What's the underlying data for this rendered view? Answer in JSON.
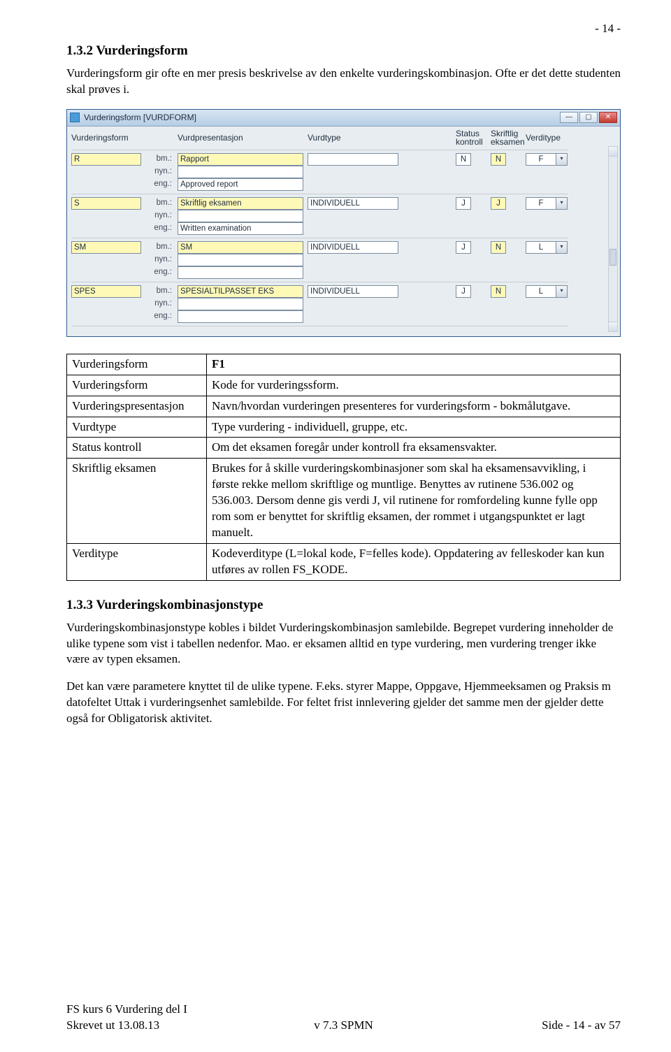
{
  "page_number_top": "- 14 -",
  "section_heading": "1.3.2 Vurderingsform",
  "intro_para": "Vurderingsform gir ofte en mer presis beskrivelse av den enkelte vurderingskombinasjon. Ofte er det dette studenten skal prøves i.",
  "window": {
    "title": "Vurderingsform  [VURDFORM]",
    "columns": {
      "c1": "Vurderingsform",
      "c2": "Vurdpresentasjon",
      "c3": "Vurdtype",
      "c4a": "Status",
      "c4b": "kontroll",
      "c5a": "Skriftlig",
      "c5b": "eksamen",
      "c6": "Verditype"
    },
    "rows": [
      {
        "code": "R",
        "bm": "Rapport",
        "type": "",
        "status": "N",
        "skriftlig": "N",
        "verdi": "F",
        "nyn": "",
        "eng": "Approved report"
      },
      {
        "code": "S",
        "bm": "Skriftlig eksamen",
        "type": "INDIVIDUELL",
        "status": "J",
        "skriftlig": "J",
        "verdi": "F",
        "nyn": "",
        "eng": "Written examination"
      },
      {
        "code": "SM",
        "bm": "SM",
        "type": "INDIVIDUELL",
        "status": "J",
        "skriftlig": "N",
        "verdi": "L",
        "nyn": "",
        "eng": ""
      },
      {
        "code": "SPES",
        "bm": "SPESIALTILPASSET EKS",
        "type": "INDIVIDUELL",
        "status": "J",
        "skriftlig": "N",
        "verdi": "L",
        "nyn": "",
        "eng": ""
      }
    ],
    "row_labels": {
      "bm": "bm.:",
      "nyn": "nyn.:",
      "eng": "eng.:"
    }
  },
  "def_table": [
    {
      "k": "Vurderingsform",
      "v": "F1"
    },
    {
      "k": "Vurderingsform",
      "v": "Kode for vurderingssform."
    },
    {
      "k": "Vurderingspresentasjon",
      "v": "Navn/hvordan vurderingen presenteres for vurderingsform - bokmålutgave."
    },
    {
      "k": "Vurdtype",
      "v": "Type vurdering - individuell, gruppe, etc."
    },
    {
      "k": "Status kontroll",
      "v": "Om det eksamen foregår under kontroll fra eksamensvakter."
    },
    {
      "k": "Skriftlig eksamen",
      "v": "Brukes for å skille vurderingskombinasjoner som skal ha eksamensavvikling, i første rekke mellom skriftlige og muntlige. Benyttes av rutinene 536.002 og 536.003. Dersom denne gis verdi J, vil rutinene for romfordeling kunne fylle opp rom som er benyttet for skriftlig eksamen, der rommet i utgangspunktet er lagt manuelt."
    },
    {
      "k": "Verditype",
      "v": "Kodeverditype (L=lokal kode, F=felles kode). Oppdatering av felleskoder kan kun utføres av rollen FS_KODE."
    }
  ],
  "section2_heading": "1.3.3 Vurderingskombinasjonstype",
  "para_a": "Vurderingskombinasjonstype kobles i bildet Vurderingskombinasjon samlebilde. Begrepet vurdering inneholder de ulike typene som vist i tabellen nedenfor. Mao. er eksamen alltid en type vurdering, men vurdering trenger ikke være av typen eksamen.",
  "para_b": "Det kan være parametere knyttet til de ulike typene. F.eks. styrer Mappe, Oppgave, Hjemmeeksamen og Praksis m datofeltet Uttak i vurderingsenhet samlebilde. For feltet frist innlevering gjelder det samme men der gjelder dette også for Obligatorisk aktivitet.",
  "footer": {
    "l1": "FS kurs 6 Vurdering del I",
    "l2": "Skrevet ut 13.08.13",
    "mid": "v 7.3 SPMN",
    "right": "Side - 14 - av 57"
  }
}
